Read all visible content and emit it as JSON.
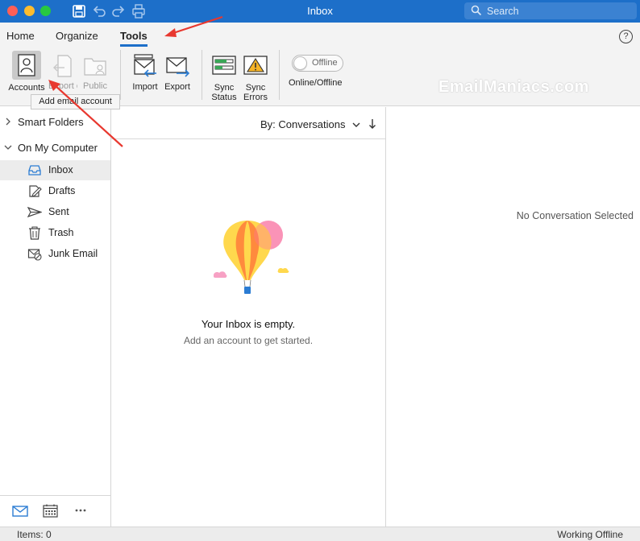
{
  "window": {
    "title": "Inbox"
  },
  "search": {
    "placeholder": "Search"
  },
  "tabs": [
    {
      "label": "Home"
    },
    {
      "label": "Organize"
    },
    {
      "label": "Tools"
    }
  ],
  "ribbon": {
    "accounts": "Accounts",
    "export_of": "Export of",
    "public_folders": "Public Folders",
    "import": "Import",
    "export": "Export",
    "sync_status": "Sync Status",
    "sync_errors": "Sync Errors",
    "offline_toggle": "Offline",
    "online_offline": "Online/Offline",
    "tooltip": "Add email account"
  },
  "watermark": "EmailManiacs.com",
  "sidebar": {
    "groups": [
      {
        "label": "Smart Folders"
      },
      {
        "label": "On My Computer"
      }
    ],
    "folders": [
      {
        "label": "Inbox",
        "icon": "inbox-icon"
      },
      {
        "label": "Drafts",
        "icon": "drafts-icon"
      },
      {
        "label": "Sent",
        "icon": "sent-icon"
      },
      {
        "label": "Trash",
        "icon": "trash-icon"
      },
      {
        "label": "Junk Email",
        "icon": "junk-icon"
      }
    ]
  },
  "list": {
    "sort_label": "By: Conversations",
    "empty_title": "Your Inbox is empty.",
    "empty_sub": "Add an account to get started."
  },
  "reading": {
    "placeholder": "No Conversation Selected"
  },
  "status": {
    "items": "Items: 0",
    "mode": "Working Offline"
  },
  "colors": {
    "accent": "#1d6fc9",
    "annotation": "#e8382f",
    "selection": "#ececec"
  }
}
